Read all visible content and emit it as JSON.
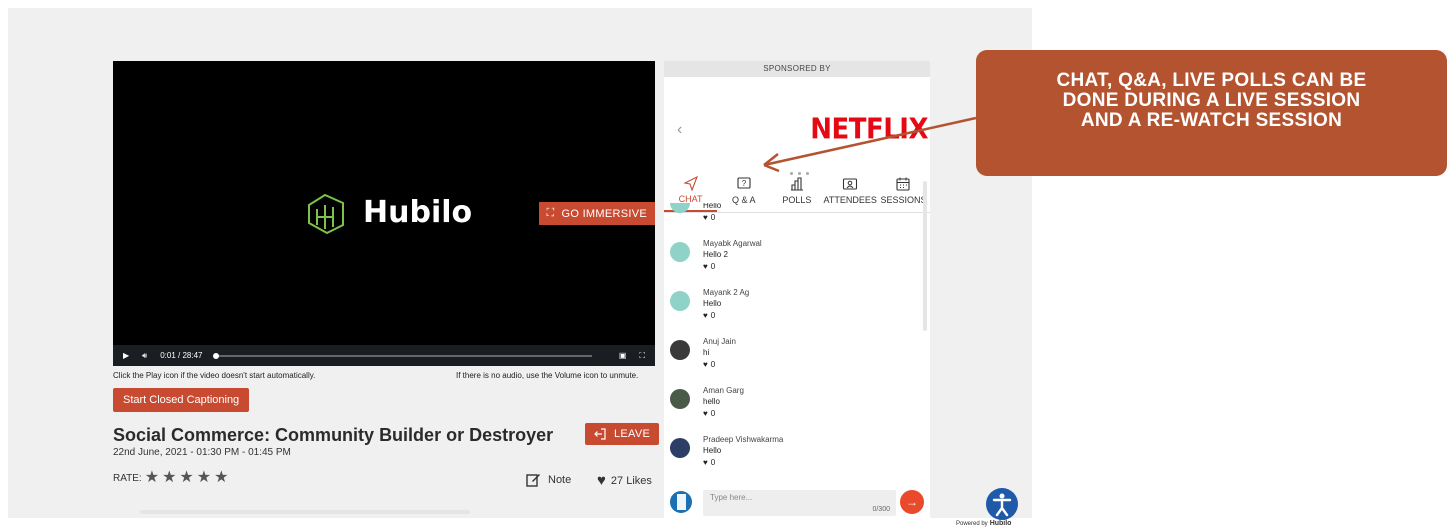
{
  "video": {
    "brand_name": "Hubilo",
    "immersive_label": "GO IMMERSIVE",
    "time": "0:01 / 28:47",
    "progress": 0.0,
    "hint_play": "Click the Play icon if the video doesn't start automatically.",
    "hint_audio": "If there is no audio, use the Volume icon to unmute."
  },
  "session": {
    "caption_button": "Start Closed Captioning",
    "title": "Social Commerce: Community Builder or Destroyer",
    "date": "22nd June, 2021 - 01:30 PM - 01:45 PM",
    "rate_label": "RATE:",
    "rating": 0,
    "leave_button": "LEAVE",
    "note_label": "Note",
    "likes_label": "27 Likes"
  },
  "panel": {
    "sponsored_by": "SPONSORED BY",
    "sponsor_logo_text": "NETFLIX",
    "tabs": [
      {
        "label": "CHAT",
        "icon": "send-icon",
        "active": true
      },
      {
        "label": "Q & A",
        "icon": "question-icon",
        "active": false
      },
      {
        "label": "POLLS",
        "icon": "bar-chart-icon",
        "active": false
      },
      {
        "label": "ATTENDEES",
        "icon": "id-card-icon",
        "active": false
      },
      {
        "label": "SESSIONS",
        "icon": "calendar-icon",
        "active": false
      }
    ],
    "messages": [
      {
        "name": "",
        "text": "Hello",
        "likes": "0",
        "avatar_color": "#8fd3c8"
      },
      {
        "name": "Mayabk Agarwal",
        "text": "Hello 2",
        "likes": "0",
        "avatar_color": "#8fd3c8"
      },
      {
        "name": "Mayank 2 Ag",
        "text": "Hello",
        "likes": "0",
        "avatar_color": "#8fd3c8"
      },
      {
        "name": "Anuj Jain",
        "text": "hi",
        "likes": "0",
        "avatar_color": "#3a3a3a"
      },
      {
        "name": "Aman Garg",
        "text": "hello",
        "likes": "0",
        "avatar_color": "#4a5a48"
      },
      {
        "name": "Pradeep Vishwakarma",
        "text": "Hello",
        "likes": "0",
        "avatar_color": "#2c3e66"
      }
    ],
    "composer": {
      "placeholder": "Type here...",
      "counter": "0/300"
    }
  },
  "callout": {
    "lines": [
      "CHAT, Q&A, LIVE POLLS CAN BE",
      "DONE DURING A LIVE SESSION",
      "AND A RE-WATCH SESSION"
    ]
  },
  "footer": {
    "powered_by": "Powered by",
    "powered_brand": "Hubilo"
  },
  "colors": {
    "accent": "#c84b31",
    "callout": "#b4532f",
    "netflix": "#e50914"
  }
}
